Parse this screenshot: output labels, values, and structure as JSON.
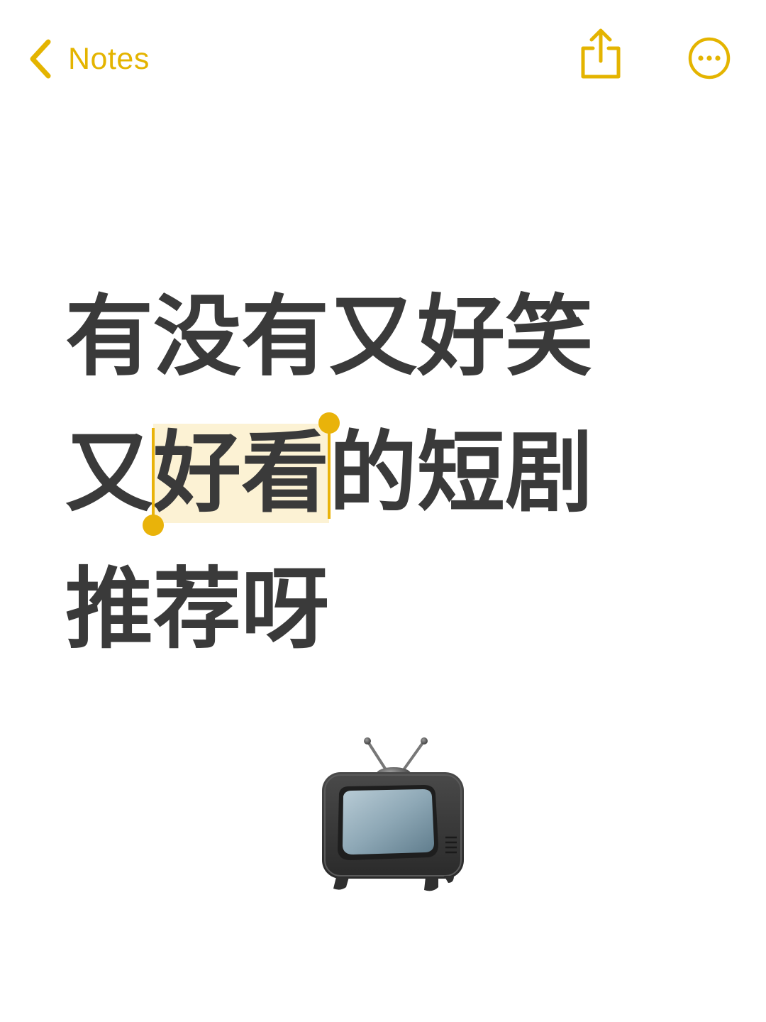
{
  "nav": {
    "back_label": "Notes",
    "accent_color": "#e4b400",
    "icons": [
      "chevron-left-icon",
      "share-icon",
      "more-icon"
    ]
  },
  "note": {
    "line1": "有没有又好笑",
    "line2_before": "又",
    "line2_selected": "好看",
    "line2_after": "的短剧",
    "line3": "推荐呀",
    "text_color": "#3a3a3a",
    "selection_color": "#fcf2d4"
  },
  "illustration": {
    "icon": "television-icon"
  }
}
